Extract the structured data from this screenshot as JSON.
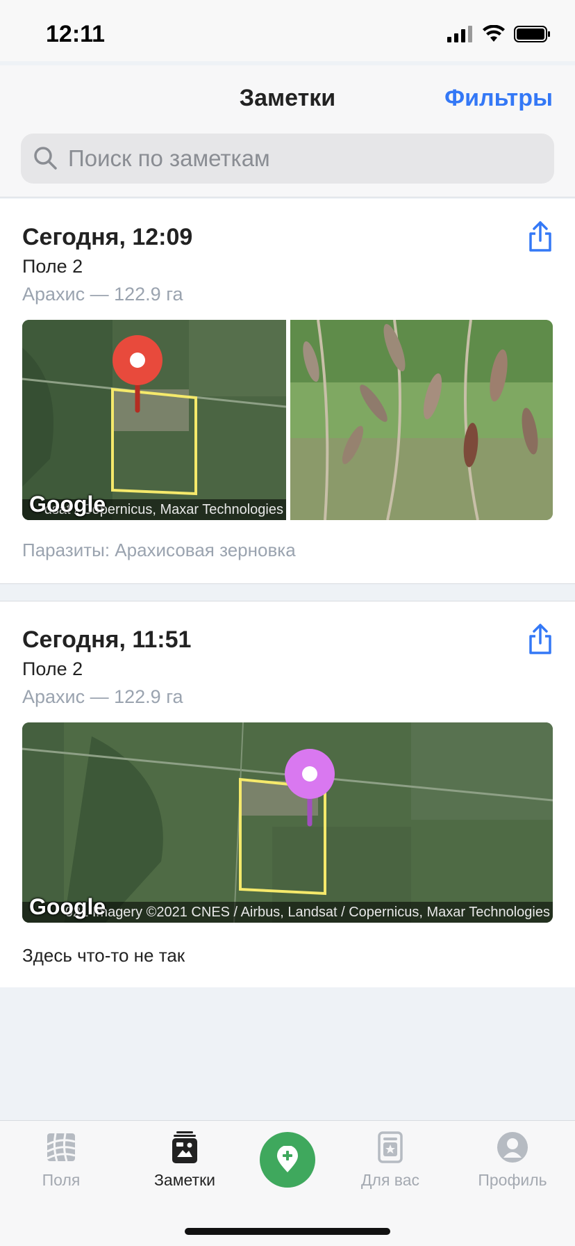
{
  "status_bar": {
    "time": "12:11"
  },
  "header": {
    "title": "Заметки",
    "filters_label": "Фильтры"
  },
  "search": {
    "placeholder": "Поиск по заметкам",
    "value": ""
  },
  "notes": [
    {
      "date": "Сегодня, 12:09",
      "field": "Поле 2",
      "crop": "Арахис — 122.9 га",
      "map_credit": "dsat / Copernicus, Maxar Technologies",
      "map_logo": "Google",
      "pin_color": "#e84a3c",
      "note": "Паразиты: Арахисовая зерновка"
    },
    {
      "date": "Сегодня, 11:51",
      "field": "Поле 2",
      "crop": "Арахис — 122.9 га",
      "map_credit": "021 Imagery ©2021 CNES / Airbus, Landsat / Copernicus, Maxar Technologies",
      "map_logo": "Google",
      "pin_color": "#d978f0",
      "note": "Здесь что-то не так"
    }
  ],
  "tabs": [
    {
      "label": "Поля",
      "icon": "fields-icon",
      "active": false
    },
    {
      "label": "Заметки",
      "icon": "notes-icon",
      "active": true
    },
    {
      "label": "Для вас",
      "icon": "for-you-icon",
      "active": false
    },
    {
      "label": "Профиль",
      "icon": "profile-icon",
      "active": false
    }
  ],
  "colors": {
    "accent": "#3478f6",
    "add_button": "#3fa85d",
    "field_outline": "#f5e96b"
  }
}
